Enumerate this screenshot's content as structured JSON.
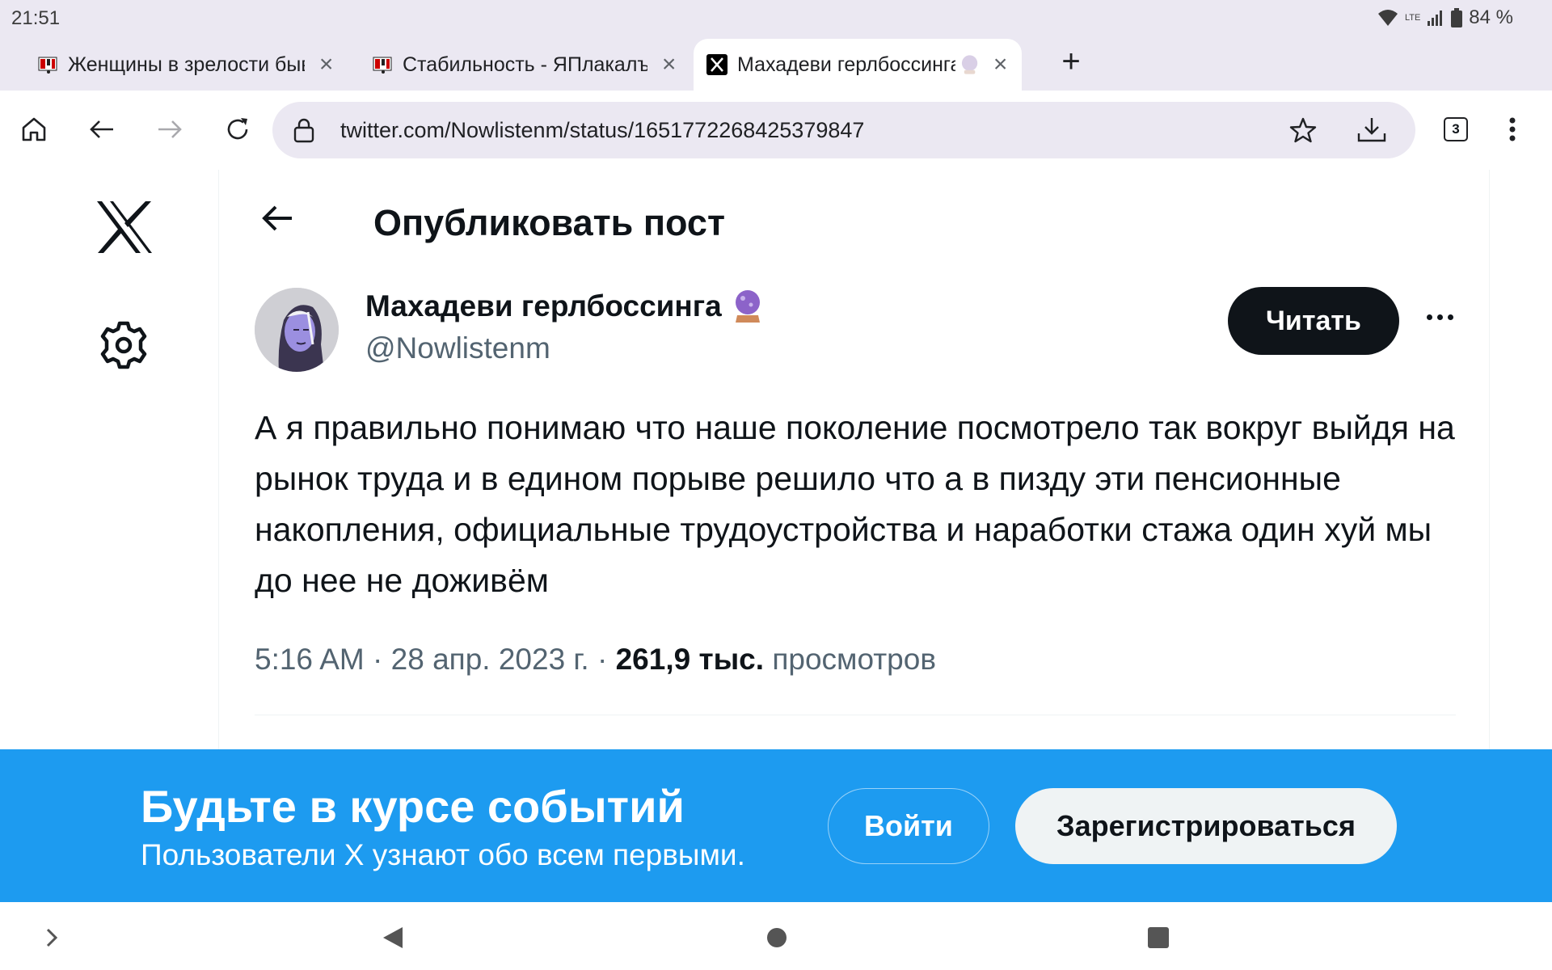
{
  "status_bar": {
    "time": "21:51",
    "network": "LTE",
    "battery": "84 %"
  },
  "tabs": [
    {
      "title": "Женщины в зрелости быв",
      "favicon": "yaplakal-icon",
      "active": false
    },
    {
      "title": "Стабильность - ЯПлакалъ",
      "favicon": "yaplakal-icon",
      "active": false
    },
    {
      "title": "Махадеви герлбоссинга",
      "favicon": "x-logo-icon",
      "active": true
    }
  ],
  "toolbar": {
    "url": "twitter.com/Nowlistenm/status/1651772268425379847",
    "tab_count": "3"
  },
  "page": {
    "title": "Опубликовать пост"
  },
  "post": {
    "author_name": "Махадеви герлбоссинга",
    "author_emoji": "crystal-ball-icon",
    "handle": "@Nowlistenm",
    "follow_label": "Читать",
    "text": "А я правильно понимаю что наше поколение посмотрело так вокруг выйдя на рынок труда и в едином порыве решило что а в пизду эти пенсионные накопления, официальные трудоустройства и наработки стажа один хуй мы до нее не доживём",
    "time": "5:16 AM",
    "sep1": " · ",
    "date": "28 апр. 2023 г.",
    "sep2": " · ",
    "views_count": "261,9 тыс.",
    "views_label": " просмотров"
  },
  "banner": {
    "title": "Будьте в курсе событий",
    "subtitle": "Пользователи X узнают обо всем первыми.",
    "login_label": "Войти",
    "signup_label": "Зарегистрироваться"
  },
  "colors": {
    "accent": "#1d9bf0",
    "text_primary": "#0f1419",
    "text_secondary": "#536471",
    "chrome_bg": "#ebe8f2"
  }
}
